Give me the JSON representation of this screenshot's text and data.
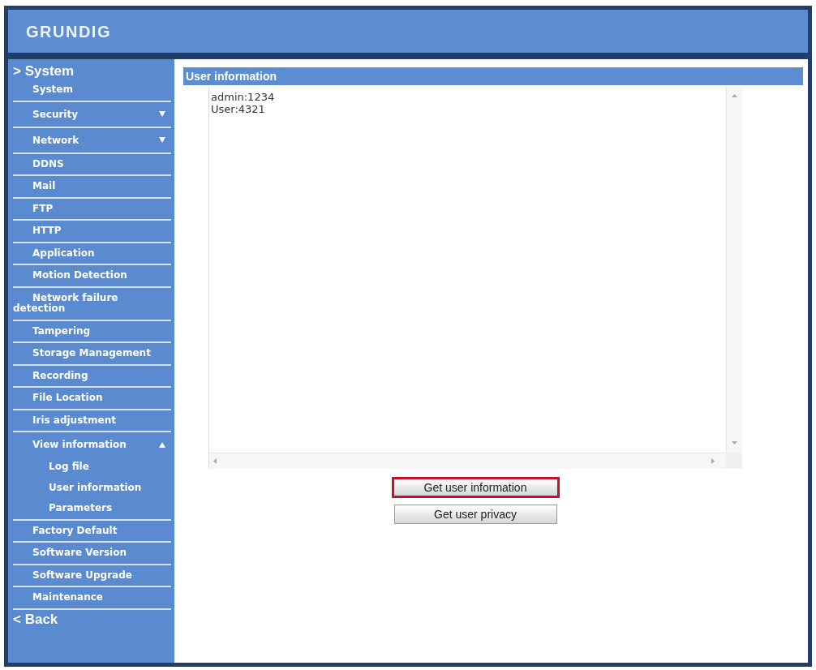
{
  "header": {
    "logo": "GRUNDIG"
  },
  "sidebar": {
    "title": "> System",
    "items": [
      {
        "kind": "link",
        "label": "System"
      },
      {
        "kind": "group",
        "label": "Security",
        "expanded": false
      },
      {
        "kind": "group",
        "label": "Network",
        "expanded": false
      },
      {
        "kind": "link",
        "label": "DDNS"
      },
      {
        "kind": "link",
        "label": "Mail"
      },
      {
        "kind": "link",
        "label": "FTP"
      },
      {
        "kind": "link",
        "label": "HTTP"
      },
      {
        "kind": "link",
        "label": "Application"
      },
      {
        "kind": "link",
        "label": "Motion Detection"
      },
      {
        "kind": "link",
        "label": "Network failure detection"
      },
      {
        "kind": "link",
        "label": "Tampering"
      },
      {
        "kind": "link",
        "label": "Storage Management"
      },
      {
        "kind": "link",
        "label": "Recording"
      },
      {
        "kind": "link",
        "label": "File Location"
      },
      {
        "kind": "link",
        "label": "Iris adjustment"
      },
      {
        "kind": "group",
        "label": "View information",
        "expanded": true,
        "children": [
          {
            "label": "Log file"
          },
          {
            "label": "User information"
          },
          {
            "label": "Parameters"
          }
        ]
      },
      {
        "kind": "link",
        "label": "Factory Default"
      },
      {
        "kind": "link",
        "label": "Software Version"
      },
      {
        "kind": "link",
        "label": "Software Upgrade"
      },
      {
        "kind": "link",
        "label": "Maintenance"
      }
    ],
    "back": "< Back"
  },
  "panel": {
    "title": "User information",
    "text_area": {
      "lines": [
        "admin:1234",
        "User:4321"
      ]
    },
    "buttons": [
      {
        "label": "Get user information",
        "highlighted": true
      },
      {
        "label": "Get user privacy",
        "highlighted": false
      }
    ]
  }
}
